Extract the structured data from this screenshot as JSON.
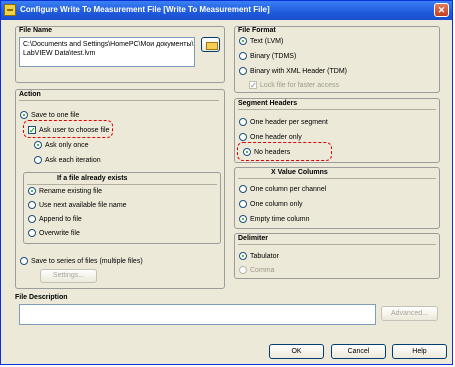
{
  "window": {
    "title": "Configure Write To Measurement File [Write To Measurement File]",
    "close_glyph": "✕"
  },
  "file_name": {
    "title": "File Name",
    "path_line1": "C:\\Documents and Settings\\HomePC\\Мои документы\\",
    "path_line2": "LabVIEW Data\\test.lvm",
    "browse_icon": "folder-icon"
  },
  "action": {
    "title": "Action",
    "save_to_one_file": "Save to one file",
    "ask_user": "Ask user to choose file",
    "ask_only_once": "Ask only once",
    "ask_each_iteration": "Ask each iteration",
    "if_exists_title": "If a file already exists",
    "rename_existing": "Rename existing file",
    "use_next": "Use next available file name",
    "append": "Append to file",
    "overwrite": "Overwrite file",
    "save_to_series": "Save to series of files (multiple files)",
    "settings_button": "Settings..."
  },
  "file_format": {
    "title": "File Format",
    "text_lvm": "Text (LVM)",
    "binary_tdms": "Binary (TDMS)",
    "binary_xml": "Binary with XML Header (TDM)",
    "lock_file": "Lock file for faster access"
  },
  "segment_headers": {
    "title": "Segment Headers",
    "one_per_segment": "One header per segment",
    "one_only": "One header only",
    "no_headers": "No headers"
  },
  "x_value_columns": {
    "title": "X Value Columns",
    "one_per_channel": "One column per channel",
    "one_only": "One column only",
    "empty_time": "Empty time column"
  },
  "delimiter": {
    "title": "Delimiter",
    "tabulator": "Tabulator",
    "comma": "Comma"
  },
  "file_description": {
    "title": "File Description",
    "value": "",
    "advanced_button": "Advanced..."
  },
  "footer": {
    "ok": "OK",
    "cancel": "Cancel",
    "help": "Help"
  },
  "colors": {
    "titlebar": "#2b6cea",
    "highlight": "#e00000",
    "selected": "#21a121"
  }
}
